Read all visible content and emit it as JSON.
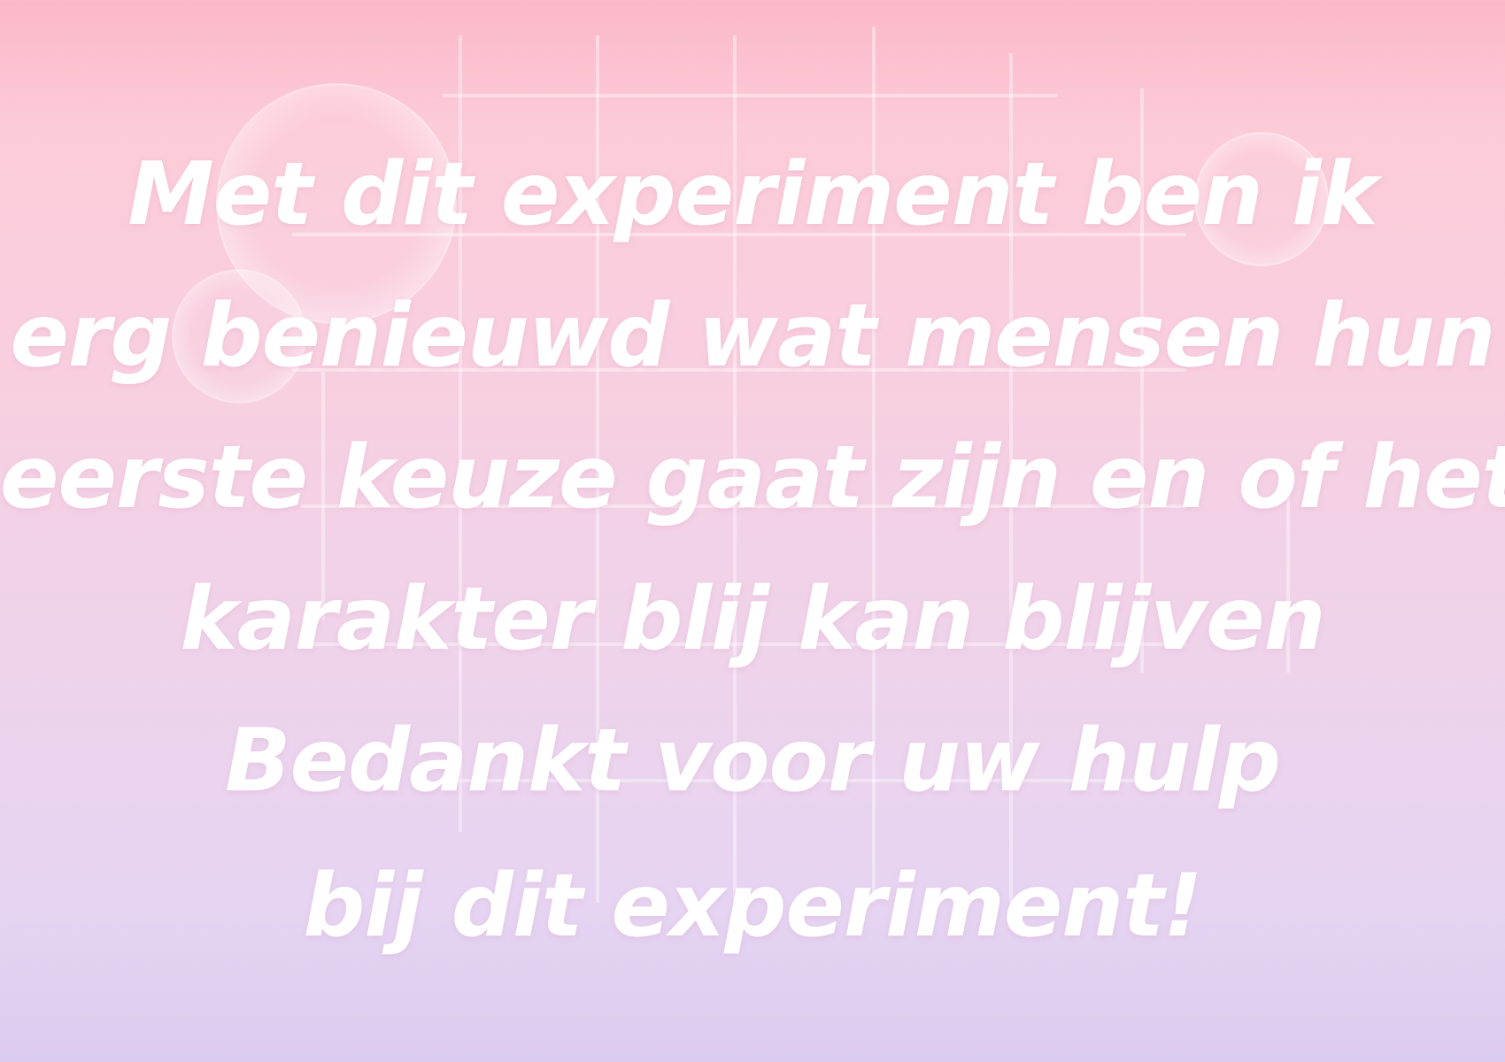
{
  "background": {
    "top_color": "#fbb8c8",
    "bottom_color": "#dccbf0",
    "text_color": "#ffffff"
  },
  "message": {
    "lines": [
      "Met dit experiment ben ik",
      "erg benieuwd wat mensen hun",
      "eerste keuze gaat zijn en of het",
      "karakter blij kan blijven",
      "Bedankt voor uw hulp",
      "bij dit experiment!"
    ]
  }
}
